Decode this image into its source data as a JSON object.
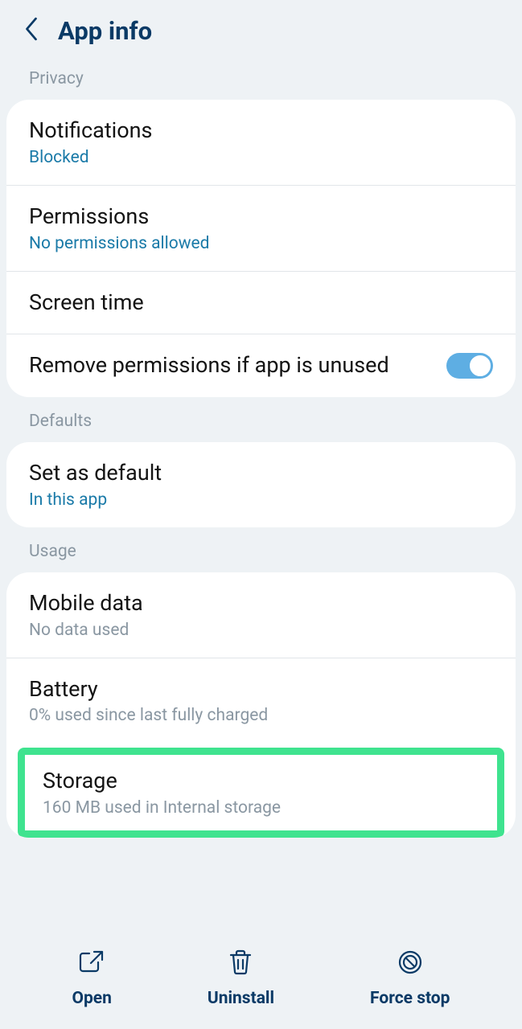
{
  "header": {
    "title": "App info"
  },
  "sections": {
    "privacy": {
      "label": "Privacy",
      "notifications": {
        "title": "Notifications",
        "sub": "Blocked"
      },
      "permissions": {
        "title": "Permissions",
        "sub": "No permissions allowed"
      },
      "screen_time": {
        "title": "Screen time"
      },
      "remove_perms": {
        "title": "Remove permissions if app is unused",
        "toggle": true
      }
    },
    "defaults": {
      "label": "Defaults",
      "set_default": {
        "title": "Set as default",
        "sub": "In this app"
      }
    },
    "usage": {
      "label": "Usage",
      "mobile_data": {
        "title": "Mobile data",
        "sub": "No data used"
      },
      "battery": {
        "title": "Battery",
        "sub": "0% used since last fully charged"
      },
      "storage": {
        "title": "Storage",
        "sub": "160 MB used in Internal storage"
      }
    }
  },
  "bottom": {
    "open": "Open",
    "uninstall": "Uninstall",
    "force_stop": "Force stop"
  }
}
